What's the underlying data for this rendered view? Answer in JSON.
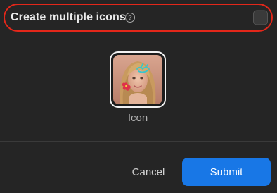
{
  "option": {
    "label": "Create multiple icons",
    "help_glyph": "?",
    "help_icon": "question-circle-icon",
    "checked": false
  },
  "preview": {
    "caption": "Icon",
    "image": "portrait-with-doodles"
  },
  "actions": {
    "cancel_label": "Cancel",
    "submit_label": "Submit"
  },
  "colors": {
    "background": "#252525",
    "highlight_ring": "#e3271a",
    "submit_bg": "#1877e6",
    "text_primary": "#ececec",
    "text_secondary": "#b5b5b5"
  }
}
